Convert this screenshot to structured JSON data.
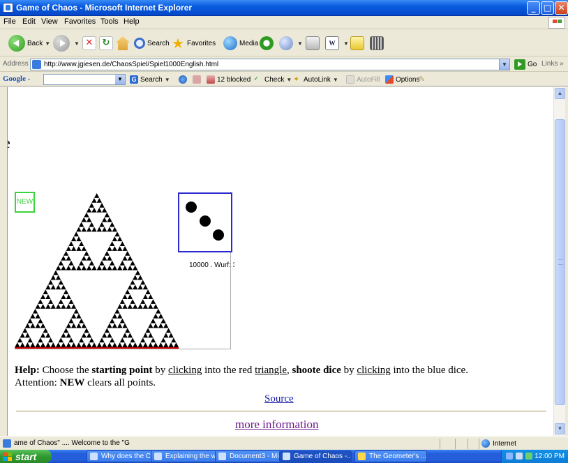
{
  "window": {
    "title": "Game of Chaos - Microsoft Internet Explorer",
    "controls": [
      "_",
      "□",
      "✕"
    ]
  },
  "menu": [
    "File",
    "Edit",
    "View",
    "Favorites",
    "Tools",
    "Help"
  ],
  "toolbar": {
    "back_label": "Back",
    "search_label": "Search",
    "favorites_label": "Favorites",
    "media_label": "Media"
  },
  "address": {
    "label": "Address",
    "url": "http://www.jgiesen.de/ChaosSpiel/Spiel1000English.html",
    "go_label": "Go",
    "links_label": "Links »"
  },
  "googlebar": {
    "label": "Google -",
    "search_label": "Search",
    "blocked_label": "12 blocked",
    "check_label": "Check",
    "autolink_label": "AutoLink",
    "autofill_label": "AutoFill",
    "options_label": "Options"
  },
  "page": {
    "cut_letter": "e",
    "new_button": "NEW",
    "roll_label": "10000 . Wurf: 3",
    "help_prefix": "Help:",
    "help_t1": " Choose the ",
    "help_b1": "starting point",
    "help_t2": " by ",
    "help_u1": "clicking",
    "help_t3": " into the red ",
    "help_u2": "triangle",
    "help_t4": ", ",
    "help_b2": "shoote dice",
    "help_t5": " by ",
    "help_u3": "clicking",
    "help_t6": " into the blue dice.",
    "attention_t1": "Attention: ",
    "attention_b": "NEW",
    "attention_t2": " clears all points.",
    "source_link": "Source",
    "more_link": "more information",
    "colors": {
      "triangle_edge": "#cc0000",
      "dice_border": "#2a2ad0",
      "new_border": "#3ad43a",
      "visited_link": "#6a1a8a",
      "link": "#1a1aa6"
    }
  },
  "status": {
    "message": "ame of Chaos\" .... Welcome to the \"G",
    "zone": "Internet"
  },
  "taskbar": {
    "start": "start",
    "tasks": [
      "Why does the C...",
      "Explaining the w...",
      "Document3 - Mic...",
      "Game of Chaos -...",
      "The Geometer's ..."
    ],
    "clock": "12:00 PM"
  }
}
